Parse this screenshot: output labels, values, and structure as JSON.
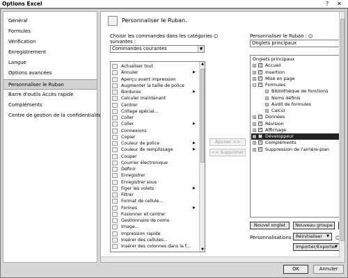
{
  "window": {
    "title": "Options Excel",
    "help_glyph": "?",
    "close_glyph": "✕"
  },
  "nav": {
    "items": [
      {
        "label": "Général",
        "selected": false
      },
      {
        "label": "Formules",
        "selected": false
      },
      {
        "label": "Vérification",
        "selected": false
      },
      {
        "label": "Enregistrement",
        "selected": false
      },
      {
        "label": "Langue",
        "selected": false
      },
      {
        "label": "Options avancées",
        "selected": false
      },
      {
        "label": "Personnaliser le Ruban",
        "selected": true
      },
      {
        "label": "Barre d'outils Accès rapide",
        "selected": false
      },
      {
        "label": "Compléments",
        "selected": false
      },
      {
        "label": "Centre de gestion de la confidentialité",
        "selected": false
      }
    ]
  },
  "main": {
    "header_title": "Personnaliser le Ruban.",
    "choose_label_1": "Choisir les commandes dans les catégories",
    "choose_label_2": "suivantes :",
    "commands_dropdown_value": "Commandes courantes",
    "ribbon_label": "Personnaliser le Ruban :",
    "ribbon_dropdown_value": "Onglets principaux",
    "info_glyph": "i",
    "dropdown_arrow": "▼",
    "commands": [
      {
        "label": "Actualiser tout",
        "submenu": false
      },
      {
        "label": "Annuler",
        "submenu": true
      },
      {
        "label": "Aperçu avant impression",
        "submenu": false
      },
      {
        "label": "Augmenter la taille de police",
        "submenu": false
      },
      {
        "label": "Bordures",
        "submenu": true
      },
      {
        "label": "Calculer maintenant",
        "submenu": false
      },
      {
        "label": "Centrer",
        "submenu": false
      },
      {
        "label": "Collage spécial...",
        "submenu": false
      },
      {
        "label": "Coller",
        "submenu": false
      },
      {
        "label": "Coller",
        "submenu": true
      },
      {
        "label": "Connexions",
        "submenu": false
      },
      {
        "label": "Copier",
        "submenu": false
      },
      {
        "label": "Couleur de police",
        "submenu": true
      },
      {
        "label": "Couleur de remplissage",
        "submenu": true
      },
      {
        "label": "Couper",
        "submenu": false
      },
      {
        "label": "Courrier électronique",
        "submenu": false
      },
      {
        "label": "Définir",
        "submenu": false
      },
      {
        "label": "Enregistrer",
        "submenu": false
      },
      {
        "label": "Enregistrer sous",
        "submenu": false
      },
      {
        "label": "Figer les volets",
        "submenu": true
      },
      {
        "label": "Filtrer",
        "submenu": false
      },
      {
        "label": "Format de cellule...",
        "submenu": false
      },
      {
        "label": "Formes",
        "submenu": true
      },
      {
        "label": "Fusionner et centrer",
        "submenu": false
      },
      {
        "label": "Gestionnaire de noms",
        "submenu": false
      },
      {
        "label": "Image...",
        "submenu": false
      },
      {
        "label": "Impression rapide",
        "submenu": false
      },
      {
        "label": "Insérer des cellules...",
        "submenu": false
      },
      {
        "label": "Insérer des colonnes dans la f...",
        "submenu": false
      }
    ],
    "add_button": "Ajouter >>",
    "remove_button": "<< Supprimer",
    "tree": [
      {
        "label": "Onglets principaux",
        "level": 0,
        "expander": "",
        "checked": null,
        "selected": false
      },
      {
        "label": "Accueil",
        "level": 1,
        "expander": "+",
        "checked": true,
        "selected": false
      },
      {
        "label": "Insertion",
        "level": 1,
        "expander": "+",
        "checked": true,
        "selected": false
      },
      {
        "label": "Mise en page",
        "level": 1,
        "expander": "+",
        "checked": true,
        "selected": false
      },
      {
        "label": "Formules",
        "level": 1,
        "expander": "−",
        "checked": true,
        "selected": false
      },
      {
        "label": "Bibliothèque de fonctions",
        "level": 2,
        "expander": "+",
        "checked": null,
        "selected": false
      },
      {
        "label": "Noms définis",
        "level": 2,
        "expander": "+",
        "checked": null,
        "selected": false
      },
      {
        "label": "Audit de formules",
        "level": 2,
        "expander": "+",
        "checked": null,
        "selected": false
      },
      {
        "label": "Calcul",
        "level": 2,
        "expander": "+",
        "checked": null,
        "selected": false
      },
      {
        "label": "Données",
        "level": 1,
        "expander": "+",
        "checked": true,
        "selected": false
      },
      {
        "label": "Révision",
        "level": 1,
        "expander": "+",
        "checked": true,
        "selected": false
      },
      {
        "label": "Affichage",
        "level": 1,
        "expander": "+",
        "checked": true,
        "selected": false
      },
      {
        "label": "Développeur",
        "level": 1,
        "expander": "+",
        "checked": true,
        "selected": true
      },
      {
        "label": "Compléments",
        "level": 1,
        "expander": "+",
        "checked": true,
        "selected": false
      },
      {
        "label": "Suppression de l'arrière-plan",
        "level": 1,
        "expander": "+",
        "checked": true,
        "selected": false
      }
    ],
    "new_tab_button": "Nouvel onglet",
    "new_group_button": "Nouveau groupe",
    "rename_button_partial": "I",
    "customizations_label": "Personnalisations :",
    "reset_button": "Réinitialiser",
    "import_export_button": "Importer/Exporter",
    "check_glyph": "✓",
    "submenu_arrow": "▶"
  },
  "footer": {
    "ok_button": "OK",
    "cancel_button": "Annuler"
  }
}
